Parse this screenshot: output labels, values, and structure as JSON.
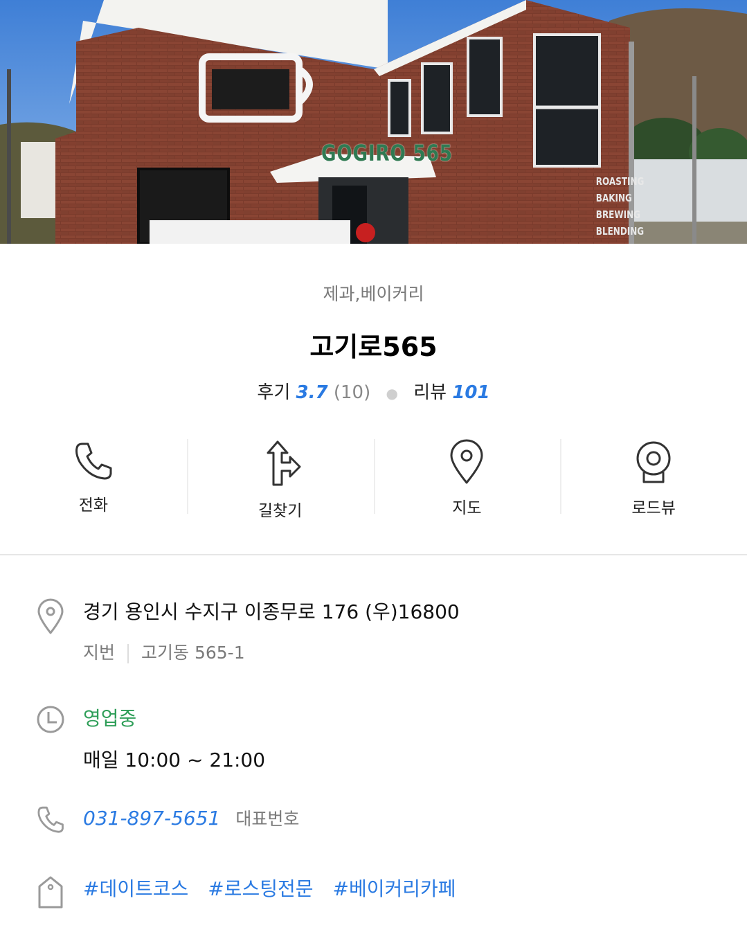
{
  "hero": {
    "sign_text": "GOGIRO 565",
    "side_lines": [
      "ROASTING",
      "BAKING",
      "BREWING",
      "BLENDING"
    ]
  },
  "place": {
    "category": "제과,베이커리",
    "name": "고기로565"
  },
  "scores": {
    "review_label": "후기",
    "review_score": "3.7",
    "review_count": "(10)",
    "blog_label": "리뷰",
    "blog_count": "101"
  },
  "actions": [
    {
      "label": "전화",
      "icon": "phone-icon"
    },
    {
      "label": "길찾기",
      "icon": "directions-icon"
    },
    {
      "label": "지도",
      "icon": "map-pin-icon"
    },
    {
      "label": "로드뷰",
      "icon": "roadview-icon"
    }
  ],
  "address": {
    "road": "경기 용인시 수지구 이종무로 176 (우)16800",
    "jibun_label": "지번",
    "jibun": "고기동 565-1"
  },
  "hours": {
    "status": "영업중",
    "schedule": "매일 10:00 ~ 21:00"
  },
  "phone": {
    "number": "031-897-5651",
    "tag": "대표번호"
  },
  "tags": [
    "#데이트코스",
    "#로스팅전문",
    "#베이커리카페"
  ],
  "colors": {
    "accent": "#2a7ae2",
    "open": "#2e9e58",
    "muted": "#7a7a7a"
  }
}
